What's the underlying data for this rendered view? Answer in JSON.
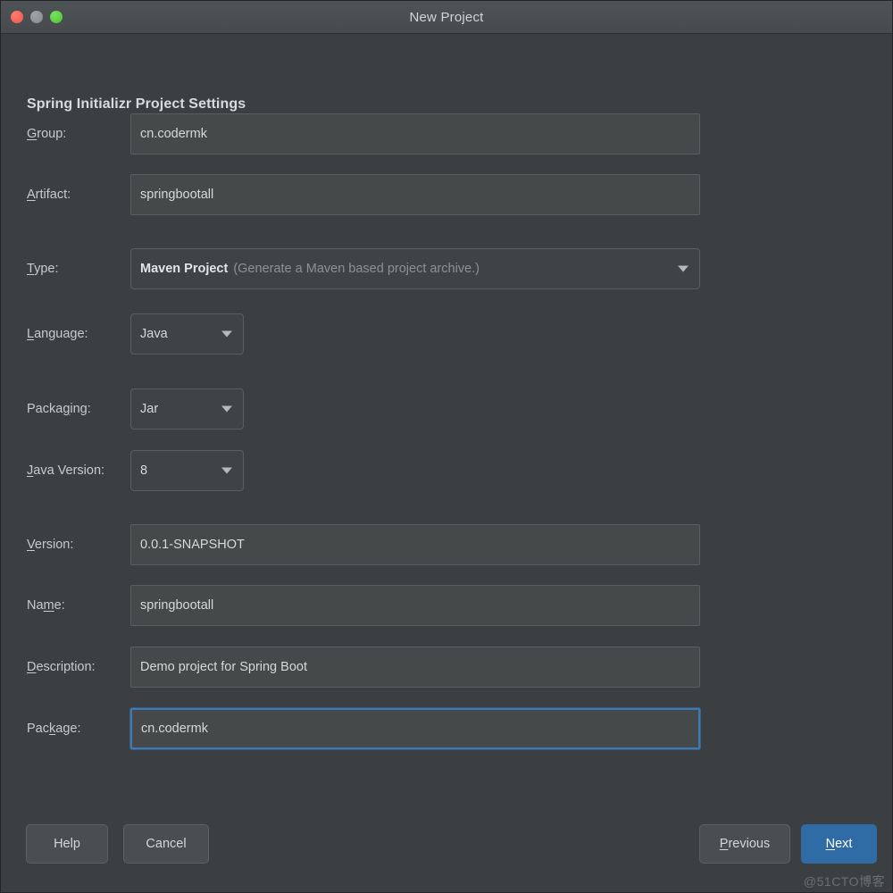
{
  "window": {
    "title": "New Project",
    "traffic_lights": [
      "close-light",
      "minimize-light",
      "zoom-light"
    ]
  },
  "header": {
    "title": "Spring Initializr Project Settings"
  },
  "form": {
    "group": {
      "label": "Group:",
      "mnemonic": "G",
      "rest": "roup:",
      "value": "cn.codermk"
    },
    "artifact": {
      "label": "Artifact:",
      "mnemonic": "A",
      "rest": "rtifact:",
      "value": "springbootall"
    },
    "type": {
      "label": "Type:",
      "mnemonic": "T",
      "rest": "ype:",
      "value": "Maven Project",
      "hint": "(Generate a Maven based project archive.)"
    },
    "language": {
      "label": "Language:",
      "mnemonic": "L",
      "rest": "anguage:",
      "value": "Java"
    },
    "packaging": {
      "label": "Packaging:",
      "pre": "Packa",
      "mnemonic": "g",
      "rest": "ing:",
      "value": "Jar"
    },
    "java_version": {
      "label": "Java Version:",
      "mnemonic": "J",
      "rest": "ava Version:",
      "value": "8"
    },
    "version": {
      "label": "Version:",
      "mnemonic": "V",
      "rest": "ersion:",
      "value": "0.0.1-SNAPSHOT"
    },
    "name": {
      "label": "Name:",
      "pre": "Na",
      "mnemonic": "m",
      "rest": "e:",
      "value": "springbootall"
    },
    "description": {
      "label": "Description:",
      "mnemonic": "D",
      "rest": "escription:",
      "value": "Demo project for Spring Boot"
    },
    "package": {
      "label": "Package:",
      "pre": "Pac",
      "mnemonic": "k",
      "rest": "age:",
      "value": "cn.codermk",
      "focused": true
    }
  },
  "buttons": {
    "help": {
      "label": "Help"
    },
    "cancel": {
      "label": "Cancel"
    },
    "previous": {
      "pre": "",
      "mnemonic": "P",
      "rest": "revious"
    },
    "next": {
      "pre": "",
      "mnemonic": "N",
      "rest": "ext"
    }
  },
  "watermark": "@51CTO博客",
  "colors": {
    "window_bg": "#3c3f41",
    "titlebar_bg": "#4a4f52",
    "field_bg": "#45494a",
    "field_border": "#5a5e60",
    "accent_focus": "#3d7ab5",
    "accent_primary": "#2f6ca6",
    "text": "#d6d8da",
    "hint_text": "#8d9194"
  }
}
